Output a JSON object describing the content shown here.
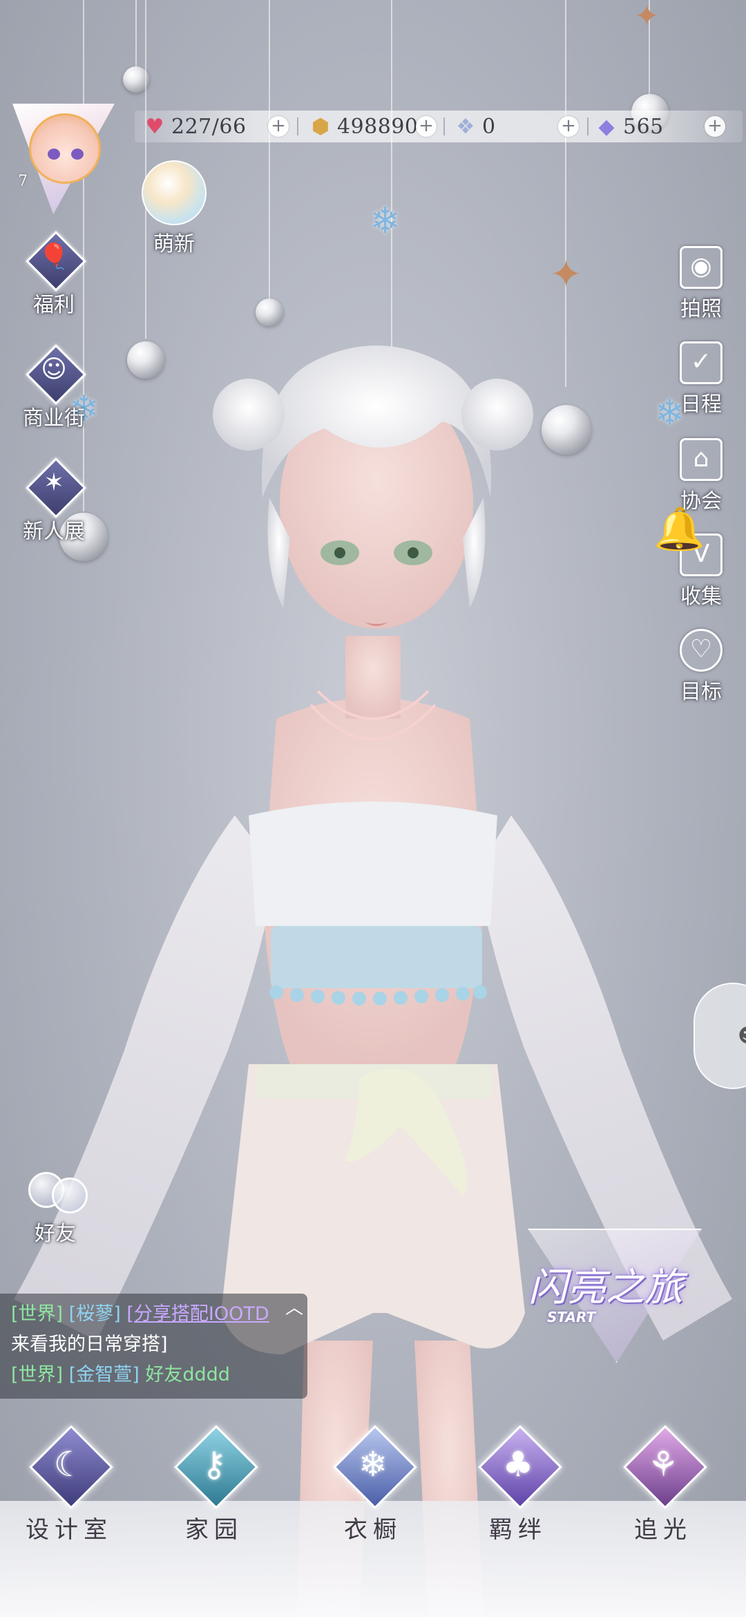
{
  "player": {
    "level": "7"
  },
  "resources": [
    {
      "name": "stamina",
      "icon": "heart-gem-icon",
      "value": "227/66",
      "color": "#e04b6a"
    },
    {
      "name": "coins",
      "icon": "coin-icon",
      "value": "498890",
      "color": "#d9a647"
    },
    {
      "name": "crystal",
      "icon": "crystal-flower-icon",
      "value": "0",
      "color": "#9fb0d8"
    },
    {
      "name": "diamonds",
      "icon": "diamond-icon",
      "value": "565",
      "color": "#8d7fe0"
    }
  ],
  "left_menu": [
    {
      "id": "newbie",
      "label": "萌新",
      "icon": "crystal-orb-icon"
    },
    {
      "id": "welfare",
      "label": "福利",
      "icon": "hot-air-balloon-icon"
    },
    {
      "id": "shopping-street",
      "label": "商业街",
      "icon": "shopping-bag-icon"
    },
    {
      "id": "new-exhibition",
      "label": "新人展",
      "icon": "star-burst-icon"
    }
  ],
  "right_menu": [
    {
      "id": "photo",
      "label": "拍照",
      "icon": "camera-icon"
    },
    {
      "id": "schedule",
      "label": "日程",
      "icon": "calendar-check-icon"
    },
    {
      "id": "guild",
      "label": "协会",
      "icon": "building-icon"
    },
    {
      "id": "collection",
      "label": "收集",
      "icon": "v-badge-icon"
    },
    {
      "id": "goals",
      "label": "目标",
      "icon": "medal-icon"
    }
  ],
  "friends": {
    "label": "好友",
    "icon": "bubbles-icon"
  },
  "chat": {
    "lines": [
      {
        "channel": "[世界]",
        "user": "[桜蓼]",
        "message": "[分享搭配IOOTD"
      },
      {
        "channel": "",
        "user": "",
        "message": "来看我的日常穿搭]"
      },
      {
        "channel": "[世界]",
        "user": "[金智萱]",
        "message": "好友dddd"
      }
    ]
  },
  "event_banner": {
    "title": "闪亮之旅",
    "subtitle": "START"
  },
  "bottom_nav": [
    {
      "id": "design-room",
      "label": "设计室",
      "icon": "moon-icon",
      "color": "#5d5a9e"
    },
    {
      "id": "home",
      "label": "家园",
      "icon": "key-icon",
      "color": "#4aa0b8"
    },
    {
      "id": "wardrobe",
      "label": "衣橱",
      "icon": "snowflake-icon",
      "color": "#6f8fd0"
    },
    {
      "id": "bonds",
      "label": "羁绊",
      "icon": "clover-icon",
      "color": "#8a6fcf"
    },
    {
      "id": "chase-light",
      "label": "追光",
      "icon": "butterfly-icon",
      "color": "#a06cc0"
    }
  ]
}
